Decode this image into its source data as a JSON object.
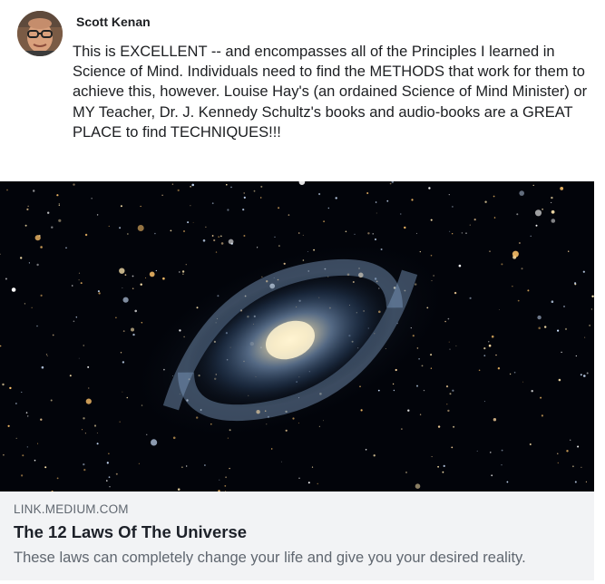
{
  "comment": {
    "author": "Scott Kenan",
    "text": "This is EXCELLENT -- and encompasses all of the Principles I learned in Science of Mind. Individuals need to find the METHODS that work for them to achieve this, however. Louise Hay's (an ordained Science of Mind Minister) or MY Teacher, Dr. J. Kennedy Schultz's books and audio-books are a GREAT PLACE to find TECHNIQUES!!!"
  },
  "link_preview": {
    "domain": "LINK.MEDIUM.COM",
    "title": "The 12 Laws Of The Universe",
    "description": "These laws can completely change your life and give you your desired reality."
  },
  "colors": {
    "meta_background": "#f2f3f5",
    "secondary_text": "#606770"
  }
}
